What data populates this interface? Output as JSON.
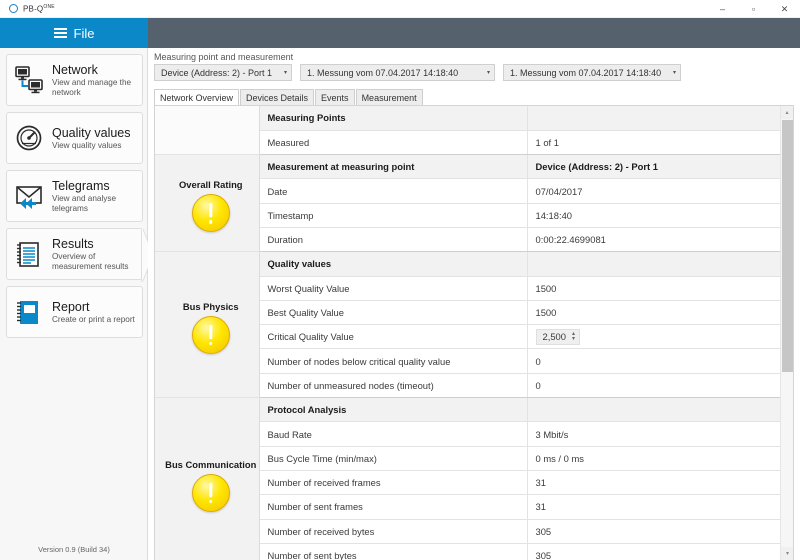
{
  "window": {
    "app_title": "PB-Q",
    "app_title_sup": "ONE",
    "app_icon": "circle-logo-icon",
    "minimize": "–",
    "maximize": "▫",
    "close": "✕"
  },
  "ribbon": {
    "file_label": "File"
  },
  "sidebar": {
    "items": [
      {
        "title": "Network",
        "desc": "View and manage the network",
        "icon": "network-monitors-icon",
        "selected": false
      },
      {
        "title": "Quality values",
        "desc": "View quality values",
        "icon": "gauge-icon",
        "selected": false
      },
      {
        "title": "Telegrams",
        "desc": "View and analyse telegrams",
        "icon": "envelope-arrows-icon",
        "selected": false
      },
      {
        "title": "Results",
        "desc": "Overview of measurement results",
        "icon": "notepad-icon",
        "selected": true
      },
      {
        "title": "Report",
        "desc": "Create or print a report",
        "icon": "book-icon",
        "selected": false
      }
    ],
    "version": "Version 0.9 (Build 34)"
  },
  "main": {
    "group_label": "Measuring point and measurement",
    "selectors": [
      {
        "value": "Device (Address: 2) - Port 1",
        "arrow": "▾"
      },
      {
        "value": "1. Messung vom 07.04.2017 14:18:40",
        "arrow": "▾"
      },
      {
        "value": "1. Messung vom 07.04.2017 14:18:40",
        "arrow": "▾"
      }
    ],
    "tabs": [
      {
        "label": "Network Overview",
        "active": true
      },
      {
        "label": "Devices Details",
        "active": false
      },
      {
        "label": "Events",
        "active": false
      },
      {
        "label": "Measurement",
        "active": false
      }
    ]
  },
  "grid": {
    "groups": [
      {
        "rating": "",
        "rating_icon": "",
        "rows": [
          {
            "label": "Measuring Points",
            "value": "",
            "section": true
          },
          {
            "label": "Measured",
            "value": "1 of 1"
          }
        ]
      },
      {
        "rating": "Overall Rating",
        "rating_icon": "warning-badge-icon",
        "rows": [
          {
            "label": "Measurement at measuring point",
            "value": "Device (Address: 2) - Port 1",
            "section": true
          },
          {
            "label": "Date",
            "value": "07/04/2017"
          },
          {
            "label": "Timestamp",
            "value": "14:18:40"
          },
          {
            "label": "Duration",
            "value": "0:00:22.4699081"
          }
        ]
      },
      {
        "rating": "Bus Physics",
        "rating_icon": "warning-badge-icon",
        "rows": [
          {
            "label": "Quality values",
            "value": "",
            "section": true
          },
          {
            "label": "Worst Quality Value",
            "value": "1500",
            "alert": true
          },
          {
            "label": "Best Quality Value",
            "value": "1500",
            "alert": true
          },
          {
            "label": "Critical Quality Value",
            "value": "2,500",
            "spinner": true
          },
          {
            "label": "Number of nodes below critical quality value",
            "value": "0"
          },
          {
            "label": "Number of unmeasured nodes (timeout)",
            "value": "0"
          }
        ]
      },
      {
        "rating": "Bus Communication",
        "rating_icon": "warning-badge-icon",
        "rows": [
          {
            "label": "Protocol Analysis",
            "value": "",
            "section": true
          },
          {
            "label": "Baud Rate",
            "value": "3 Mbit/s"
          },
          {
            "label": "Bus Cycle Time (min/max)",
            "value": "0 ms / 0 ms"
          },
          {
            "label": "Number of received frames",
            "value": "31"
          },
          {
            "label": "Number of sent frames",
            "value": "31"
          },
          {
            "label": "Number of received bytes",
            "value": "305"
          },
          {
            "label": "Number of sent bytes",
            "value": "305"
          }
        ]
      }
    ],
    "spinner_up": "▴",
    "spinner_down": "▾",
    "scroll_up": "▴",
    "scroll_down": "▾"
  },
  "colors": {
    "accent_blue": "#0b88c8",
    "ribbon_gray": "#56616e",
    "alert_red": "#c0504d",
    "badge_yellow": "#ffe600"
  }
}
